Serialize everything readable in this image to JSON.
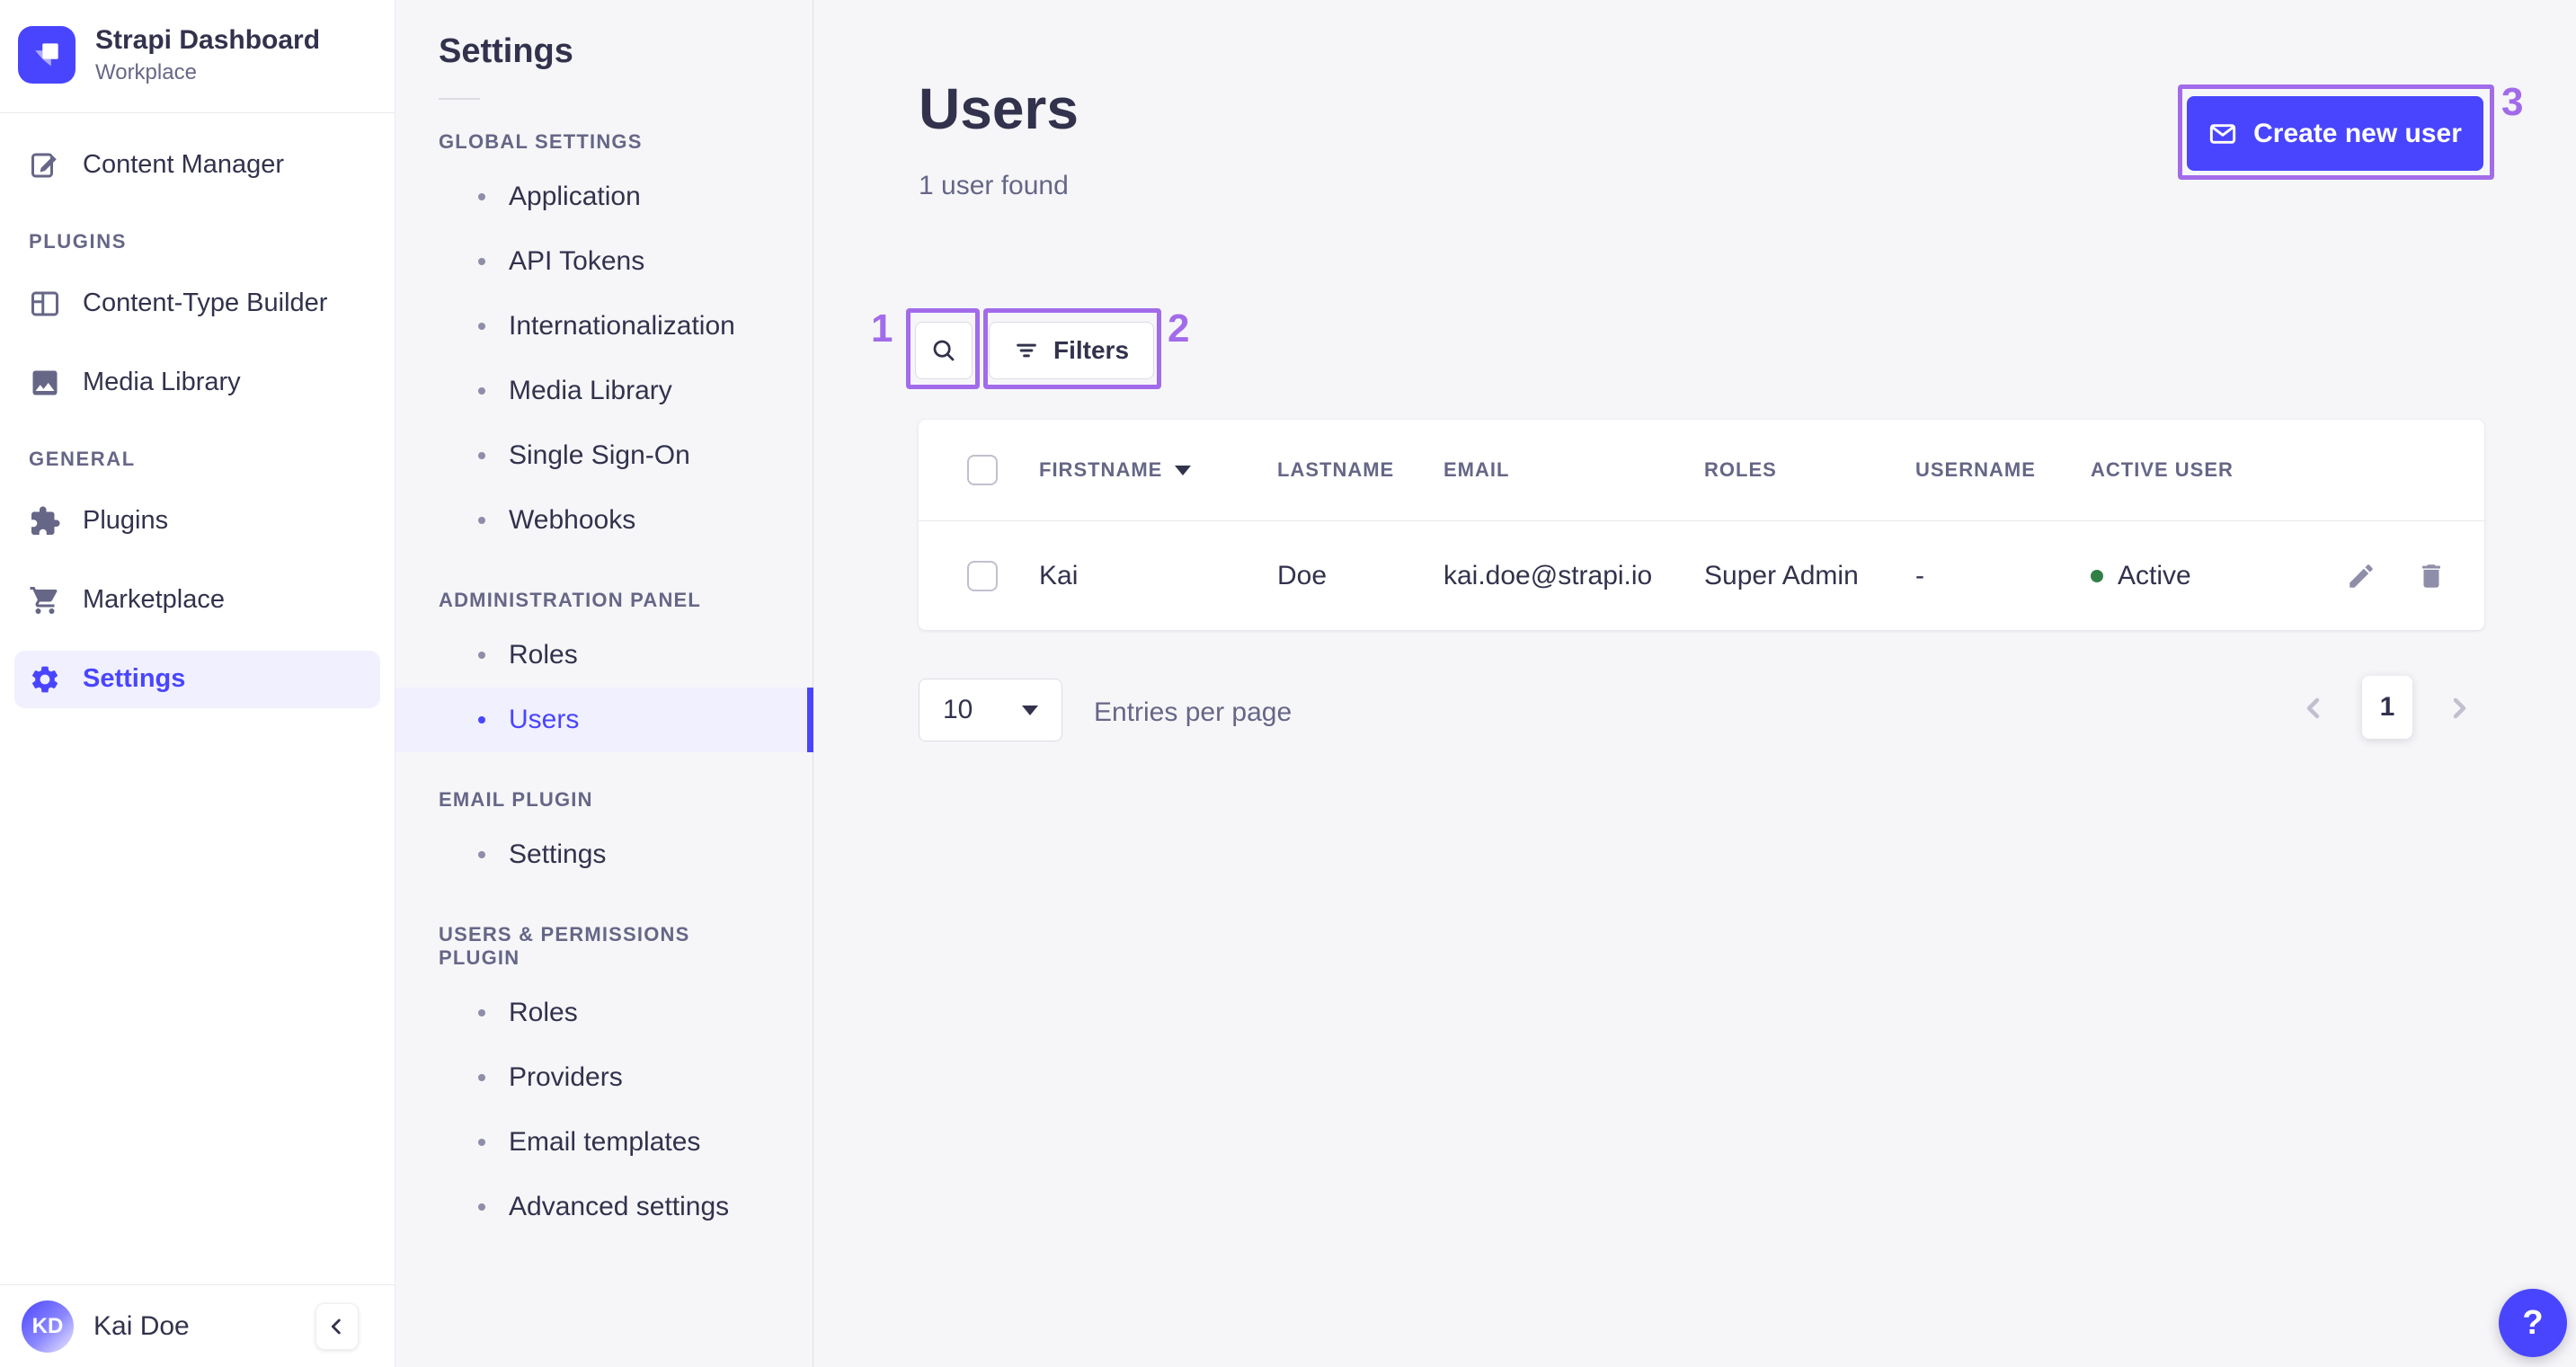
{
  "brand": {
    "name": "Strapi Dashboard",
    "workspace": "Workplace"
  },
  "main_nav": {
    "top_items": [
      {
        "label": "Content Manager",
        "icon": "pencil-square-icon"
      }
    ],
    "sections": [
      {
        "label": "PLUGINS",
        "items": [
          {
            "label": "Content-Type Builder",
            "icon": "layout-icon"
          },
          {
            "label": "Media Library",
            "icon": "image-icon"
          }
        ]
      },
      {
        "label": "GENERAL",
        "items": [
          {
            "label": "Plugins",
            "icon": "puzzle-icon"
          },
          {
            "label": "Marketplace",
            "icon": "cart-icon"
          },
          {
            "label": "Settings",
            "icon": "gear-icon",
            "active": true
          }
        ]
      }
    ],
    "user": {
      "initials": "KD",
      "name": "Kai Doe"
    }
  },
  "sub_nav": {
    "title": "Settings",
    "sections": [
      {
        "label": "GLOBAL SETTINGS",
        "items": [
          {
            "label": "Application"
          },
          {
            "label": "API Tokens"
          },
          {
            "label": "Internationalization"
          },
          {
            "label": "Media Library"
          },
          {
            "label": "Single Sign-On"
          },
          {
            "label": "Webhooks"
          }
        ]
      },
      {
        "label": "ADMINISTRATION PANEL",
        "items": [
          {
            "label": "Roles"
          },
          {
            "label": "Users",
            "active": true
          }
        ]
      },
      {
        "label": "EMAIL PLUGIN",
        "items": [
          {
            "label": "Settings"
          }
        ]
      },
      {
        "label": "USERS & PERMISSIONS PLUGIN",
        "items": [
          {
            "label": "Roles"
          },
          {
            "label": "Providers"
          },
          {
            "label": "Email templates"
          },
          {
            "label": "Advanced settings"
          }
        ]
      }
    ]
  },
  "header": {
    "title": "Users",
    "subtitle": "1 user found",
    "create_button_label": "Create new user"
  },
  "toolbar": {
    "filters_label": "Filters"
  },
  "table": {
    "columns": [
      {
        "label": "FIRSTNAME",
        "sorted": "desc"
      },
      {
        "label": "LASTNAME"
      },
      {
        "label": "EMAIL"
      },
      {
        "label": "ROLES"
      },
      {
        "label": "USERNAME"
      },
      {
        "label": "ACTIVE USER"
      }
    ],
    "rows": [
      {
        "firstname": "Kai",
        "lastname": "Doe",
        "email": "kai.doe@strapi.io",
        "roles": "Super Admin",
        "username": "-",
        "status": "Active"
      }
    ]
  },
  "pagination": {
    "page_size": "10",
    "entries_label": "Entries per page",
    "current_page": "1"
  },
  "help": {
    "label": "?"
  },
  "annotations": {
    "one": "1",
    "two": "2",
    "three": "3"
  },
  "colors": {
    "primary": "#4945FF",
    "annotation": "#A26BEA",
    "status_active": "#328048",
    "active_bg": "#F0F0FF"
  }
}
